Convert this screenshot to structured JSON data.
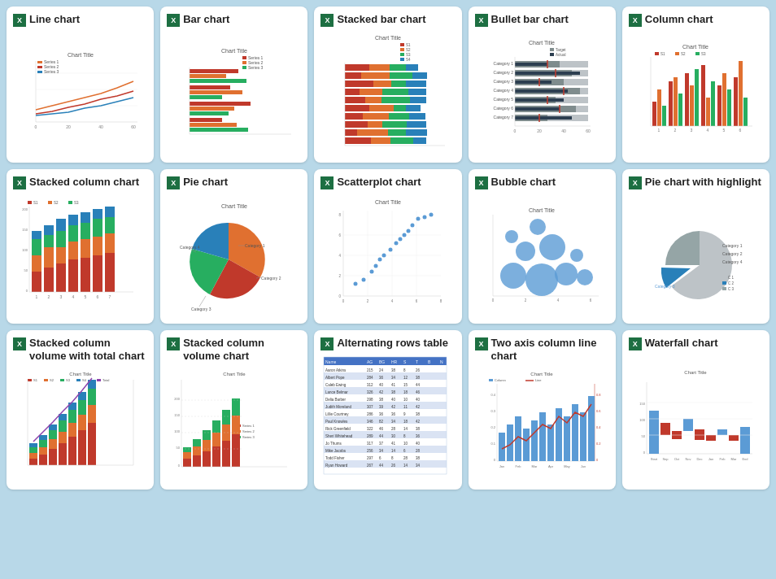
{
  "cards": [
    {
      "id": "line-chart",
      "title": "Line chart",
      "type": "line"
    },
    {
      "id": "bar-chart",
      "title": "Bar chart",
      "type": "bar"
    },
    {
      "id": "stacked-bar-chart",
      "title": "Stacked bar chart",
      "type": "stacked-bar"
    },
    {
      "id": "bullet-bar-chart",
      "title": "Bullet bar chart",
      "type": "bullet-bar"
    },
    {
      "id": "column-chart",
      "title": "Column chart",
      "type": "column"
    },
    {
      "id": "stacked-column-chart",
      "title": "Stacked column chart",
      "type": "stacked-column"
    },
    {
      "id": "pie-chart",
      "title": "Pie chart",
      "type": "pie"
    },
    {
      "id": "scatterplot-chart",
      "title": "Scatterplot chart",
      "type": "scatter"
    },
    {
      "id": "bubble-chart",
      "title": "Bubble chart",
      "type": "bubble"
    },
    {
      "id": "pie-highlight-chart",
      "title": "Pie chart with highlight",
      "type": "pie-highlight"
    },
    {
      "id": "stacked-column-volume-total",
      "title": "Stacked column volume with total chart",
      "type": "stacked-col-vol-total"
    },
    {
      "id": "stacked-column-volume",
      "title": "Stacked column volume chart",
      "type": "stacked-col-vol"
    },
    {
      "id": "alternating-rows",
      "title": "Alternating rows table",
      "type": "table"
    },
    {
      "id": "two-axis-chart",
      "title": "Two axis column line chart",
      "type": "two-axis"
    },
    {
      "id": "waterfall-chart",
      "title": "Waterfall chart",
      "type": "waterfall"
    }
  ]
}
